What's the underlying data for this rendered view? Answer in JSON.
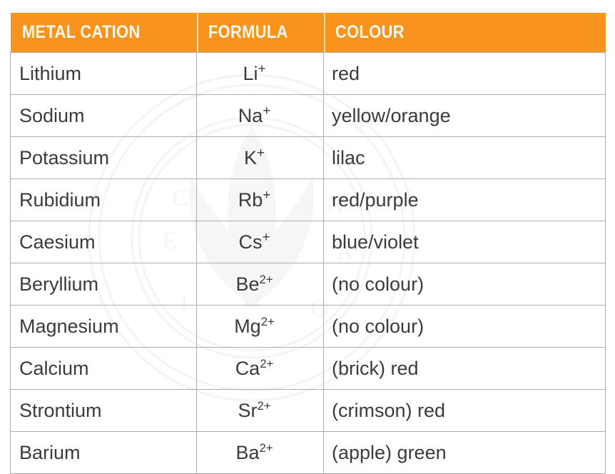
{
  "table": {
    "accent_color": "#F8941D",
    "header_text_color": "#FDF6EA",
    "body_text_color": "#3B3B3B",
    "border_color": "#ACACAC",
    "headers": [
      {
        "label": "METAL CATION"
      },
      {
        "label": "FORMULA"
      },
      {
        "label": "COLOUR"
      }
    ],
    "rows": [
      {
        "cation": "Lithium",
        "formula_symbol": "Li",
        "formula_charge": "+",
        "colour": "red"
      },
      {
        "cation": "Sodium",
        "formula_symbol": "Na",
        "formula_charge": "+",
        "colour": "yellow/orange"
      },
      {
        "cation": "Potassium",
        "formula_symbol": "K",
        "formula_charge": "+",
        "colour": "lilac"
      },
      {
        "cation": "Rubidium",
        "formula_symbol": "Rb",
        "formula_charge": "+",
        "colour": "red/purple"
      },
      {
        "cation": "Caesium",
        "formula_symbol": "Cs",
        "formula_charge": "+",
        "colour": "blue/violet"
      },
      {
        "cation": "Beryllium",
        "formula_symbol": "Be",
        "formula_charge": "2+",
        "colour": "(no colour)"
      },
      {
        "cation": "Magnesium",
        "formula_symbol": "Mg",
        "formula_charge": "2+",
        "colour": "(no colour)"
      },
      {
        "cation": "Calcium",
        "formula_symbol": "Ca",
        "formula_charge": "2+",
        "colour": "(brick) red"
      },
      {
        "cation": "Strontium",
        "formula_symbol": "Sr",
        "formula_charge": "2+",
        "colour": "(crimson) red"
      },
      {
        "cation": "Barium",
        "formula_symbol": "Ba",
        "formula_charge": "2+",
        "colour": "(apple) green"
      }
    ]
  }
}
